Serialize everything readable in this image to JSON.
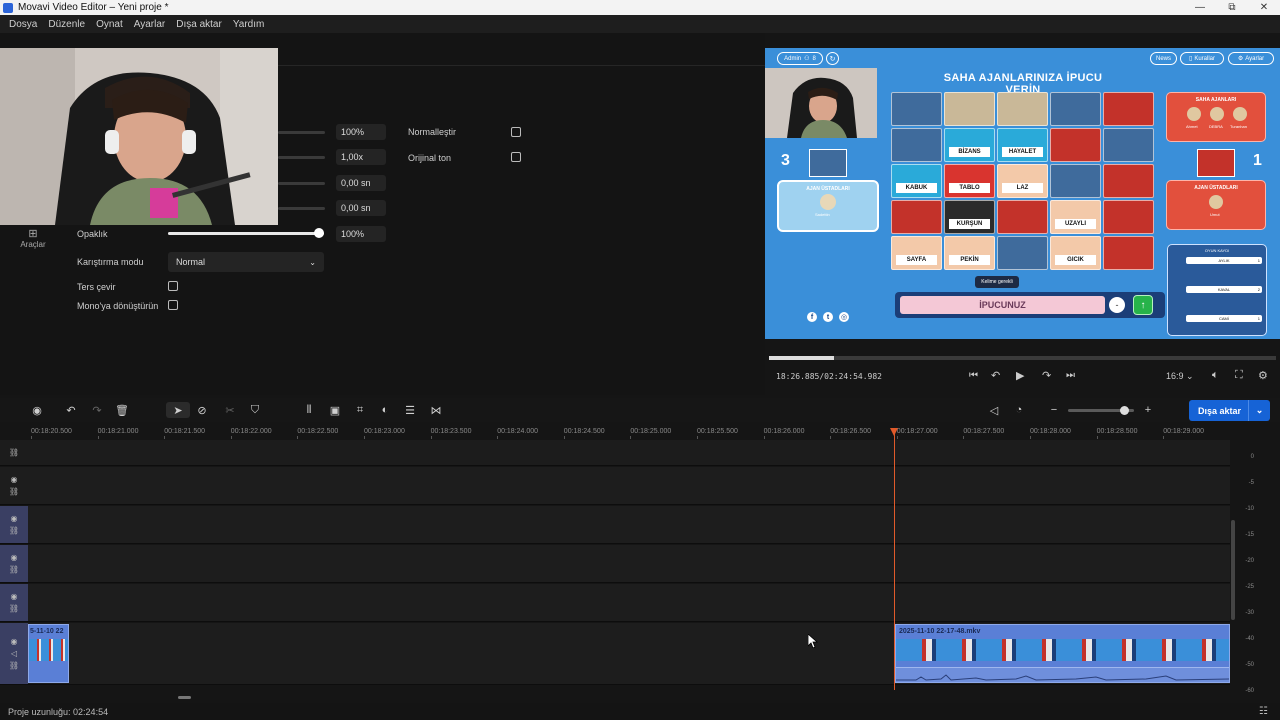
{
  "window": {
    "title": "Movavi Video Editor – Yeni proje *",
    "minimize": "—",
    "maximize": "⧉",
    "close": "✕"
  },
  "menu": [
    "Dosya",
    "Düzenle",
    "Oynat",
    "Ayarlar",
    "Dışa aktar",
    "Yardım"
  ],
  "tools_tab": {
    "label": "Araçlar"
  },
  "properties": {
    "values": [
      "100%",
      "1,00x",
      "0,00 sn",
      "0,00 sn"
    ],
    "normalize_label": "Normalleştir",
    "original_tone_label": "Orijinal ton",
    "opacity_label": "Opaklık",
    "opacity_value": "100%",
    "opacity_fraction": 1.0,
    "blend_mode_label": "Karıştırma modu",
    "blend_mode_value": "Normal",
    "invert_label": "Ters çevir",
    "mono_label": "Mono'ya dönüştürün"
  },
  "preview": {
    "game": {
      "admin_button": "Admin",
      "admin_count": "8",
      "top_buttons": [
        "News",
        "Kurallar",
        "Ayarlar"
      ],
      "title": "SAHA AJANLARINIZA İPUCU VERİN",
      "left_score": "3",
      "right_score": "1",
      "left_masters_label": "AJAN ÜSTADLARI",
      "left_master_name": "Sadettin",
      "right_agents_label": "SAHA AJANLARI",
      "right_agents": [
        "Ahmet",
        "DEBRA",
        "Turanhan"
      ],
      "right_masters_label": "AJAN ÜSTADLARI",
      "right_master_name": "Umut",
      "cards": [
        "",
        "",
        "",
        "",
        "",
        "",
        "BİZANS",
        "HAYALET",
        "",
        "",
        "KABUK",
        "TABLO",
        "LAZ",
        "",
        "",
        "",
        "KURŞUN",
        "",
        "UZAYLI",
        "",
        "SAYFA",
        "PEKİN",
        "",
        "GICIK",
        ""
      ],
      "card_colors": [
        "#3f6b9c",
        "#c9b898",
        "#c9b898",
        "#3f6b9c",
        "#c3322a",
        "#3f6b9c",
        "#2aaad9",
        "#2aaad9",
        "#c3322a",
        "#3f6b9c",
        "#2aaad9",
        "#d9342f",
        "#f3c9a9",
        "#3f6b9c",
        "#c3322a",
        "#c3322a",
        "#2b2b2b",
        "#c3322a",
        "#f3c9a9",
        "#c3322a",
        "#f3c9a9",
        "#f3c9a9",
        "#3f6b9c",
        "#f3c9a9",
        "#c3322a"
      ],
      "hint_tooltip": "Kelime gerekli",
      "hint_placeholder": "İPUCUNUZ",
      "hint_count": "-",
      "log_title": "OYUN KAYDI",
      "log_entries": [
        "AYLIK",
        "KAVAL",
        "CAMİ"
      ],
      "log_counts": [
        "1",
        "2",
        "1"
      ],
      "social_icons": [
        "f",
        "t",
        "◎"
      ]
    },
    "progress_fraction": 0.128,
    "timecode": "18:26.885/02:24:54.982",
    "aspect": "16:9"
  },
  "timeline": {
    "ruler": [
      "00:18:20.500",
      "00:18:21.000",
      "00:18:21.500",
      "00:18:22.000",
      "00:18:22.500",
      "00:18:23.000",
      "00:18:23.500",
      "00:18:24.000",
      "00:18:24.500",
      "00:18:25.000",
      "00:18:25.500",
      "00:18:26.000",
      "00:18:26.500",
      "00:18:27.000",
      "00:18:27.500",
      "00:18:28.000",
      "00:18:28.500",
      "00:18:29.000"
    ],
    "clip_left_title": "5-11-10 22",
    "clip_right_title": "2025-11-10 22-17-48.mkv",
    "export_label": "Dışa aktar",
    "vu_labels": [
      "0",
      "-5",
      "-10",
      "-15",
      "-20",
      "-25",
      "-30",
      "-40",
      "-50",
      "-60"
    ]
  },
  "status": {
    "project_length": "Proje uzunluğu: 02:24:54"
  },
  "colors": {
    "accent": "#1663d6",
    "clip": "#5a7fd6",
    "playhead": "#e05a2a",
    "game_bg": "#3a8fd9"
  }
}
